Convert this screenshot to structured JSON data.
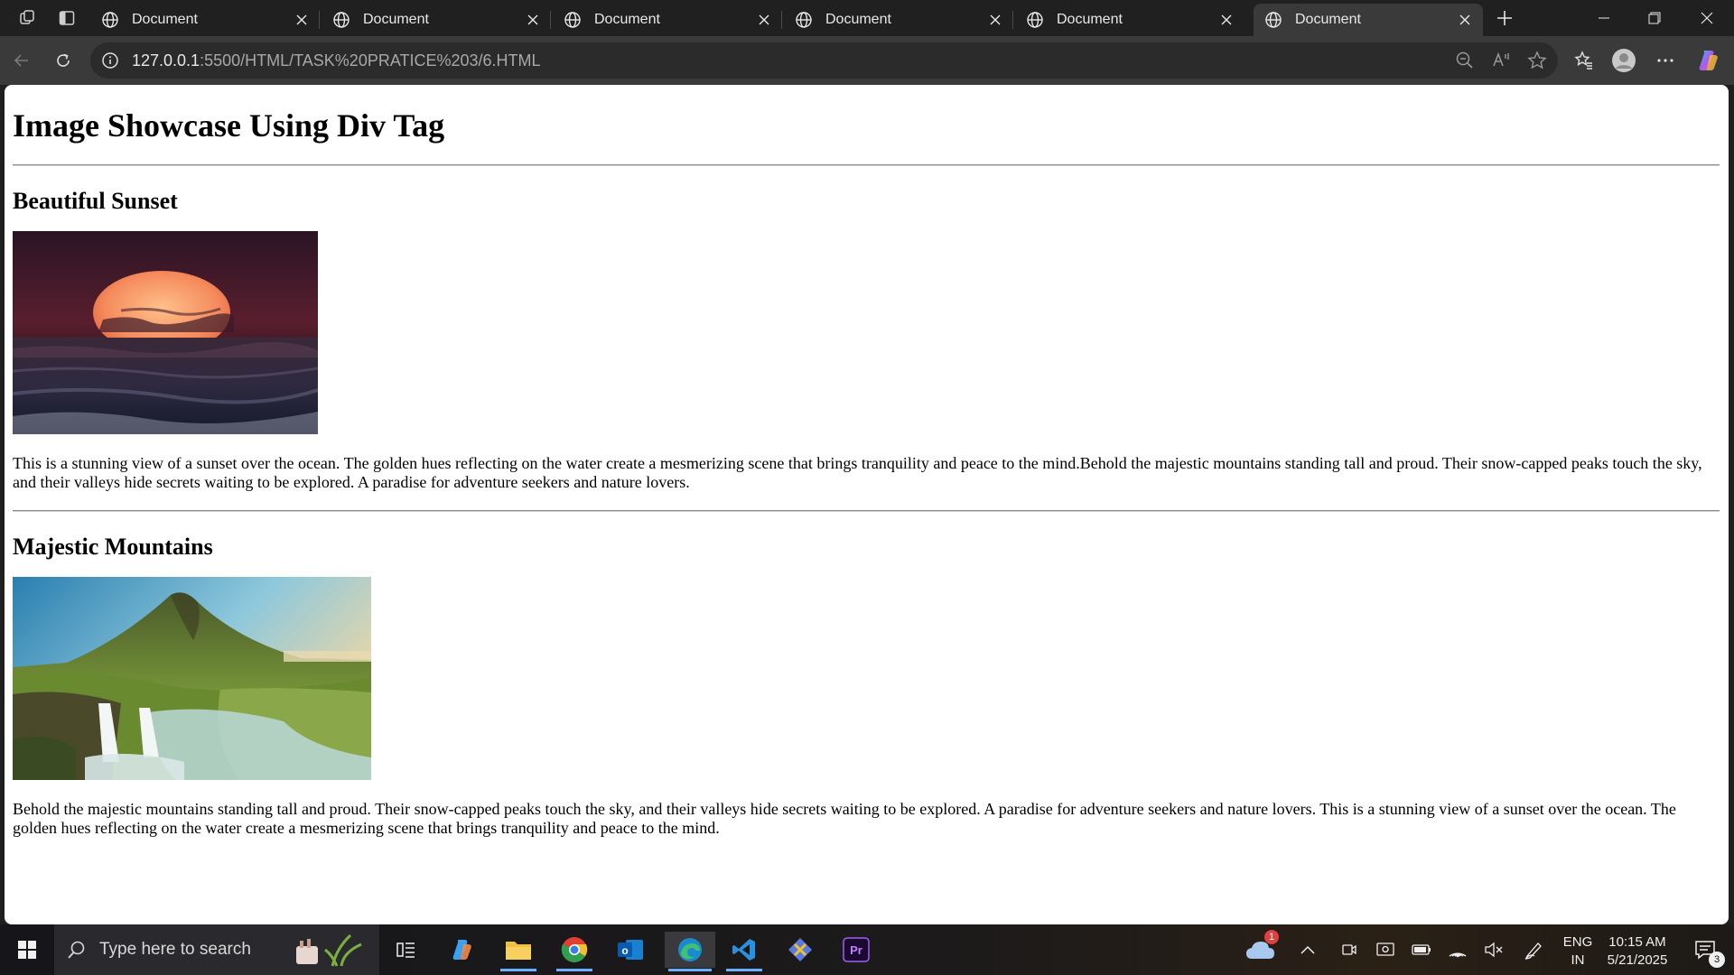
{
  "browser": {
    "tabs": [
      {
        "title": "Document",
        "active": false
      },
      {
        "title": "Document",
        "active": false
      },
      {
        "title": "Document",
        "active": false
      },
      {
        "title": "Document",
        "active": false
      },
      {
        "title": "Document",
        "active": false
      },
      {
        "title": "Document",
        "active": true
      }
    ],
    "url_host": "127.0.0.1",
    "url_rest": ":5500/HTML/TASK%20PRATICE%203/6.HTML"
  },
  "page": {
    "title": "Image Showcase Using Div Tag",
    "sections": [
      {
        "heading": "Beautiful Sunset",
        "image": "sunset-over-ocean",
        "text": "This is a stunning view of a sunset over the ocean. The golden hues reflecting on the water create a mesmerizing scene that brings tranquility and peace to the mind.Behold the majestic mountains standing tall and proud. Their snow-capped peaks touch the sky, and their valleys hide secrets waiting to be explored. A paradise for adventure seekers and nature lovers."
      },
      {
        "heading": "Majestic Mountains",
        "image": "mountain-waterfall-landscape",
        "text": "Behold the majestic mountains standing tall and proud. Their snow-capped peaks touch the sky, and their valleys hide secrets waiting to be explored. A paradise for adventure seekers and nature lovers. This is a stunning view of a sunset over the ocean. The golden hues reflecting on the water create a mesmerizing scene that brings tranquility and peace to the mind."
      }
    ]
  },
  "taskbar": {
    "search_placeholder": "Type here to search",
    "weather_badge": "1",
    "lang_line1": "ENG",
    "lang_line2": "IN",
    "time": "10:15 AM",
    "date": "5/21/2025",
    "notification_count": "3"
  },
  "colors": {
    "accent": "#6ab0ff",
    "tab_active_bg": "#3a3a3a",
    "page_bg": "#ffffff"
  }
}
